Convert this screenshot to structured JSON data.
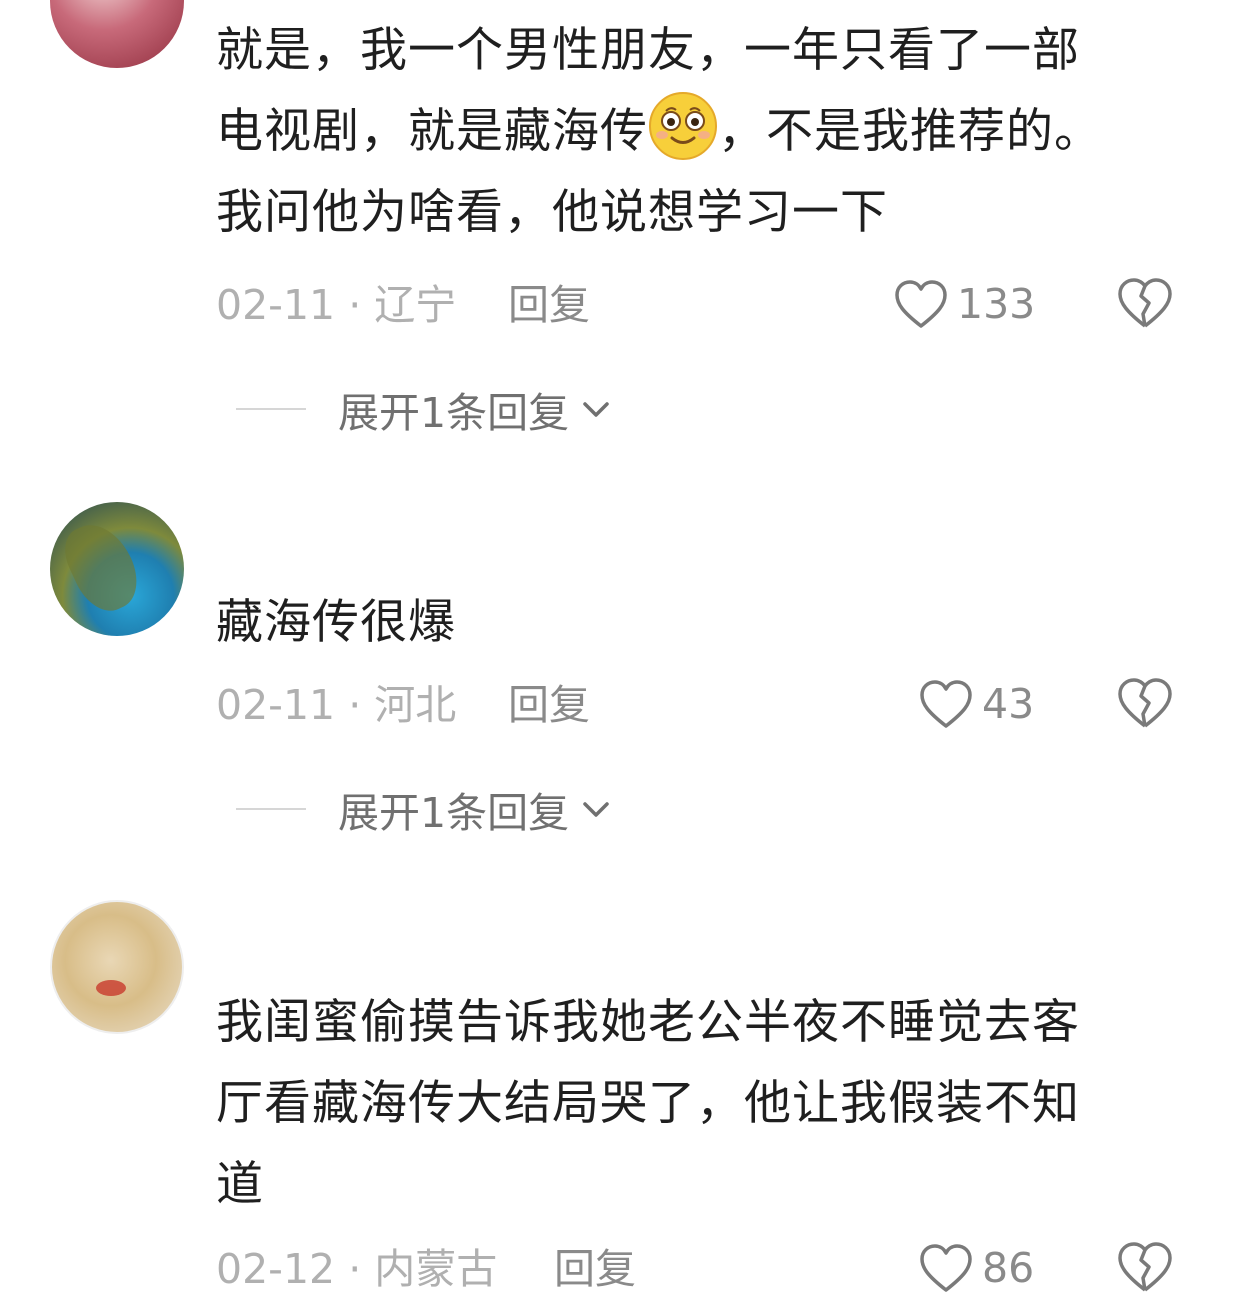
{
  "comments": [
    {
      "username": "",
      "text_lines": [
        "就是，我一个男性朋友，一年只看了一部",
        "电视剧，就是藏海传",
        "，不是我推荐的。",
        "我问他为啥看，他说想学习一下"
      ],
      "emoji_icon": "smiling-face-emoji-icon",
      "date": "02-11",
      "separator": "·",
      "location": "辽宁",
      "reply_label": "回复",
      "like_count": "133",
      "expand_label": "展开1条回复"
    },
    {
      "username": "",
      "text_lines": [
        "藏海传很爆"
      ],
      "date": "02-11",
      "separator": "·",
      "location": "河北",
      "reply_label": "回复",
      "like_count": "43",
      "expand_label": "展开1条回复"
    },
    {
      "username": "",
      "text_lines": [
        "我闺蜜偷摸告诉我她老公半夜不睡觉去客",
        "厅看藏海传大结局哭了，他让我假装不知",
        "道"
      ],
      "date": "02-12",
      "separator": "·",
      "location": "内蒙古",
      "reply_label": "回复",
      "like_count": "86"
    }
  ],
  "icons": {
    "like": "heart-outline-icon",
    "dislike": "broken-heart-icon",
    "expand": "chevron-down-icon"
  },
  "colors": {
    "text": "#1f1f1f",
    "meta": "#b0b0b0",
    "action": "#8a8a8a",
    "expand": "#707070"
  }
}
